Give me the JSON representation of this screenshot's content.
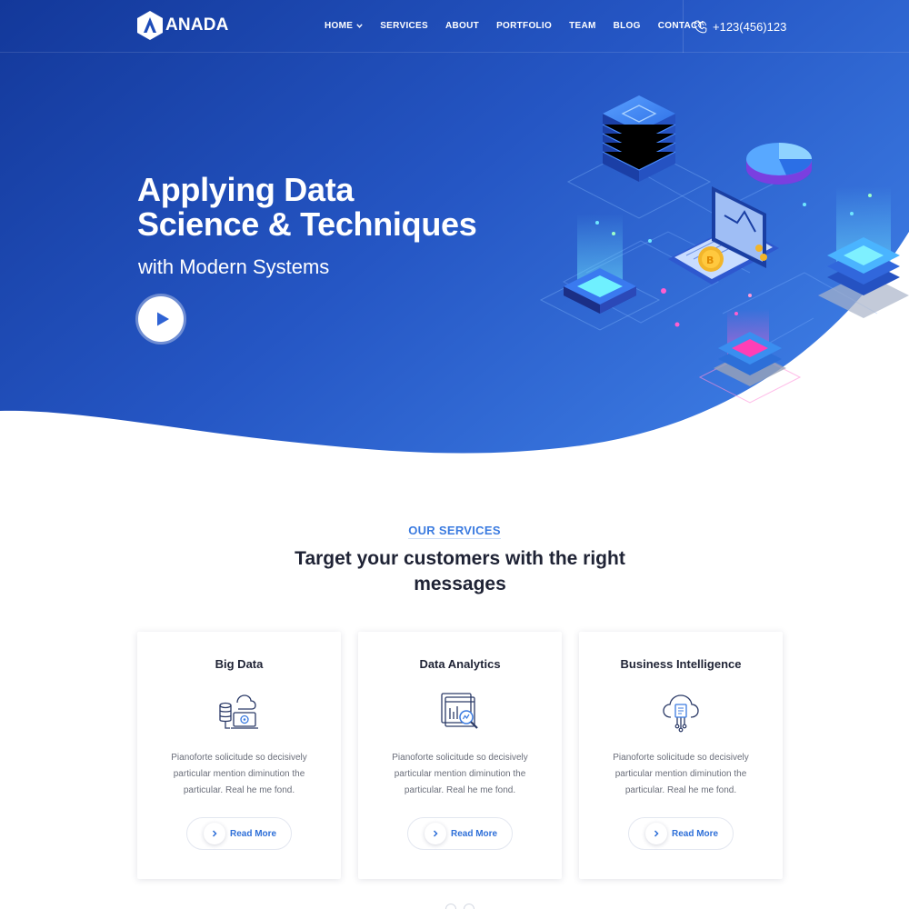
{
  "brand": {
    "name": "ANADA",
    "logo_letter": "A"
  },
  "nav": {
    "items": [
      {
        "label": "HOME",
        "dropdown": true
      },
      {
        "label": "SERVICES"
      },
      {
        "label": "ABOUT"
      },
      {
        "label": "PORTFOLIO"
      },
      {
        "label": "TEAM"
      },
      {
        "label": "BLOG"
      },
      {
        "label": "CONTACT"
      }
    ],
    "phone": "+123(456)123",
    "phone_icon": "phone-icon"
  },
  "hero": {
    "title_line1": "Applying Data",
    "title_line2": "Science & Techniques",
    "subtitle": "with Modern Systems",
    "play_icon": "play-icon",
    "gradient_start": "#13389a",
    "gradient_end": "#3570da"
  },
  "services": {
    "tag": "OUR SERVICES",
    "heading": "Target your customers with the right messages",
    "cards": [
      {
        "title": "Big Data",
        "icon": "cloud-database-icon",
        "text": "Pianoforte solicitude so decisively particular mention diminution the particular. Real he me fond.",
        "button": "Read More"
      },
      {
        "title": "Data Analytics",
        "icon": "analytics-magnifier-icon",
        "text": "Pianoforte solicitude so decisively particular mention diminution the particular. Real he me fond.",
        "button": "Read More"
      },
      {
        "title": "Business Intelligence",
        "icon": "cloud-circuit-icon",
        "text": "Pianoforte solicitude so decisively particular mention diminution the particular. Real he me fond.",
        "button": "Read More"
      }
    ]
  },
  "colors": {
    "accent": "#3b7be0",
    "heading": "#1f2335",
    "body_text": "#6a6e7a"
  }
}
